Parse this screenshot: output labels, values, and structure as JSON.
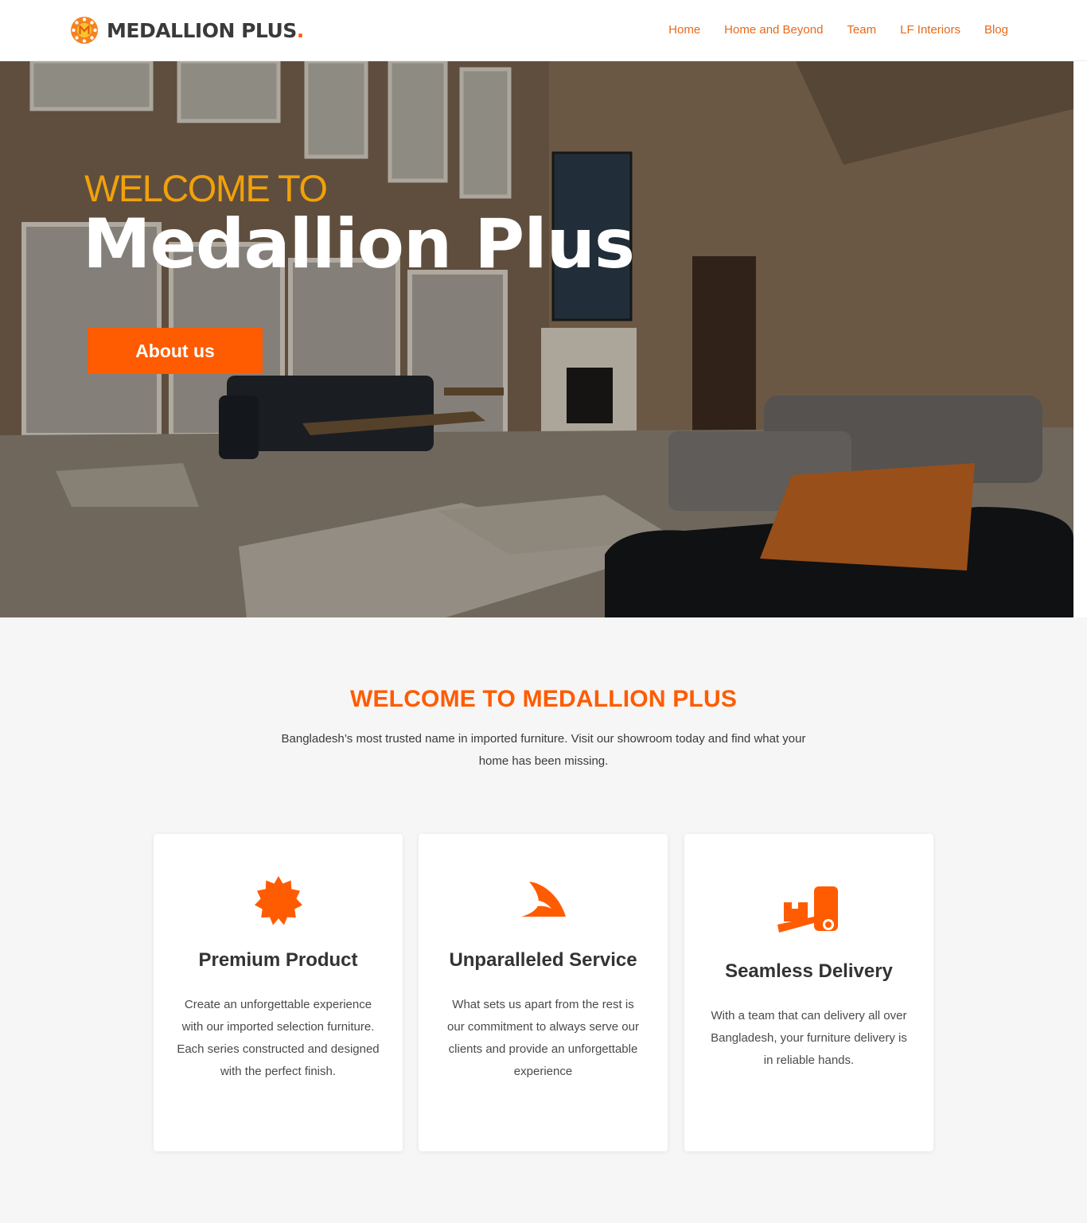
{
  "brand": {
    "name": "MEDALLION PLUS",
    "dot": ".",
    "logo_icon": "medallion-logo-icon",
    "accent": "#ff5b00"
  },
  "nav": {
    "items": [
      {
        "label": "Home"
      },
      {
        "label": "Home and Beyond"
      },
      {
        "label": "Team"
      },
      {
        "label": "LF Interiors"
      },
      {
        "label": "Blog"
      }
    ],
    "color": "#e8691a"
  },
  "hero": {
    "kicker": "WELCOME TO",
    "title": "Medallion Plus",
    "button_label": "About us",
    "kicker_color": "#f1a10a",
    "button_color": "#ff5b00"
  },
  "intro": {
    "title": "WELCOME TO MEDALLION PLUS",
    "text_line1": "Bangladesh’s most trusted name in imported furniture. Visit our showroom today and find what your",
    "text_line2": "home has been missing."
  },
  "features": [
    {
      "icon": "badge-star-icon",
      "title": "Premium Product",
      "lines": [
        "Create an unforgettable experience",
        "with our imported selection furniture.",
        "Each series constructed and designed",
        "with the perfect finish."
      ]
    },
    {
      "icon": "shark-fin-icon",
      "title": "Unparalleled Service",
      "lines": [
        "What sets us apart from the rest is",
        "our commitment to always serve our",
        "clients and provide an unforgettable",
        "experience"
      ]
    },
    {
      "icon": "hand-truck-icon",
      "title": "Seamless Delivery",
      "lines": [
        "With a team that can delivery all over",
        "Bangladesh, your furniture delivery is",
        "in reliable hands."
      ]
    }
  ]
}
